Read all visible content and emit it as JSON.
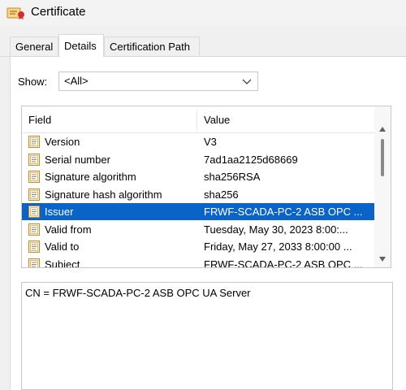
{
  "window": {
    "title": "Certificate",
    "icon": "certificate-icon"
  },
  "tabs": [
    {
      "label": "General",
      "selected": false
    },
    {
      "label": "Details",
      "selected": true
    },
    {
      "label": "Certification Path",
      "selected": false
    }
  ],
  "show": {
    "label": "Show:",
    "value": "<All>"
  },
  "list": {
    "columns": [
      "Field",
      "Value"
    ],
    "rows": [
      {
        "field": "Version",
        "value": "V3",
        "icon": "cert-field-icon"
      },
      {
        "field": "Serial number",
        "value": "7ad1aa2125d68669",
        "icon": "cert-field-icon"
      },
      {
        "field": "Signature algorithm",
        "value": "sha256RSA",
        "icon": "cert-field-icon"
      },
      {
        "field": "Signature hash algorithm",
        "value": "sha256",
        "icon": "cert-field-icon"
      },
      {
        "field": "Issuer",
        "value": "FRWF-SCADA-PC-2 ASB OPC ...",
        "icon": "cert-field-icon",
        "selected": true
      },
      {
        "field": "Valid from",
        "value": "Tuesday, May 30, 2023 8:00:...",
        "icon": "cert-field-icon"
      },
      {
        "field": "Valid to",
        "value": "Friday, May 27, 2033 8:00:00 ...",
        "icon": "cert-field-icon"
      },
      {
        "field": "Subject",
        "value": "FRWF-SCADA-PC-2 ASB OPC ...",
        "icon": "cert-field-icon"
      }
    ]
  },
  "detail": {
    "text": "CN = FRWF-SCADA-PC-2 ASB OPC UA Server"
  },
  "colors": {
    "selection": "#0a64c8",
    "dialog_bg": "#f0f0f0"
  }
}
